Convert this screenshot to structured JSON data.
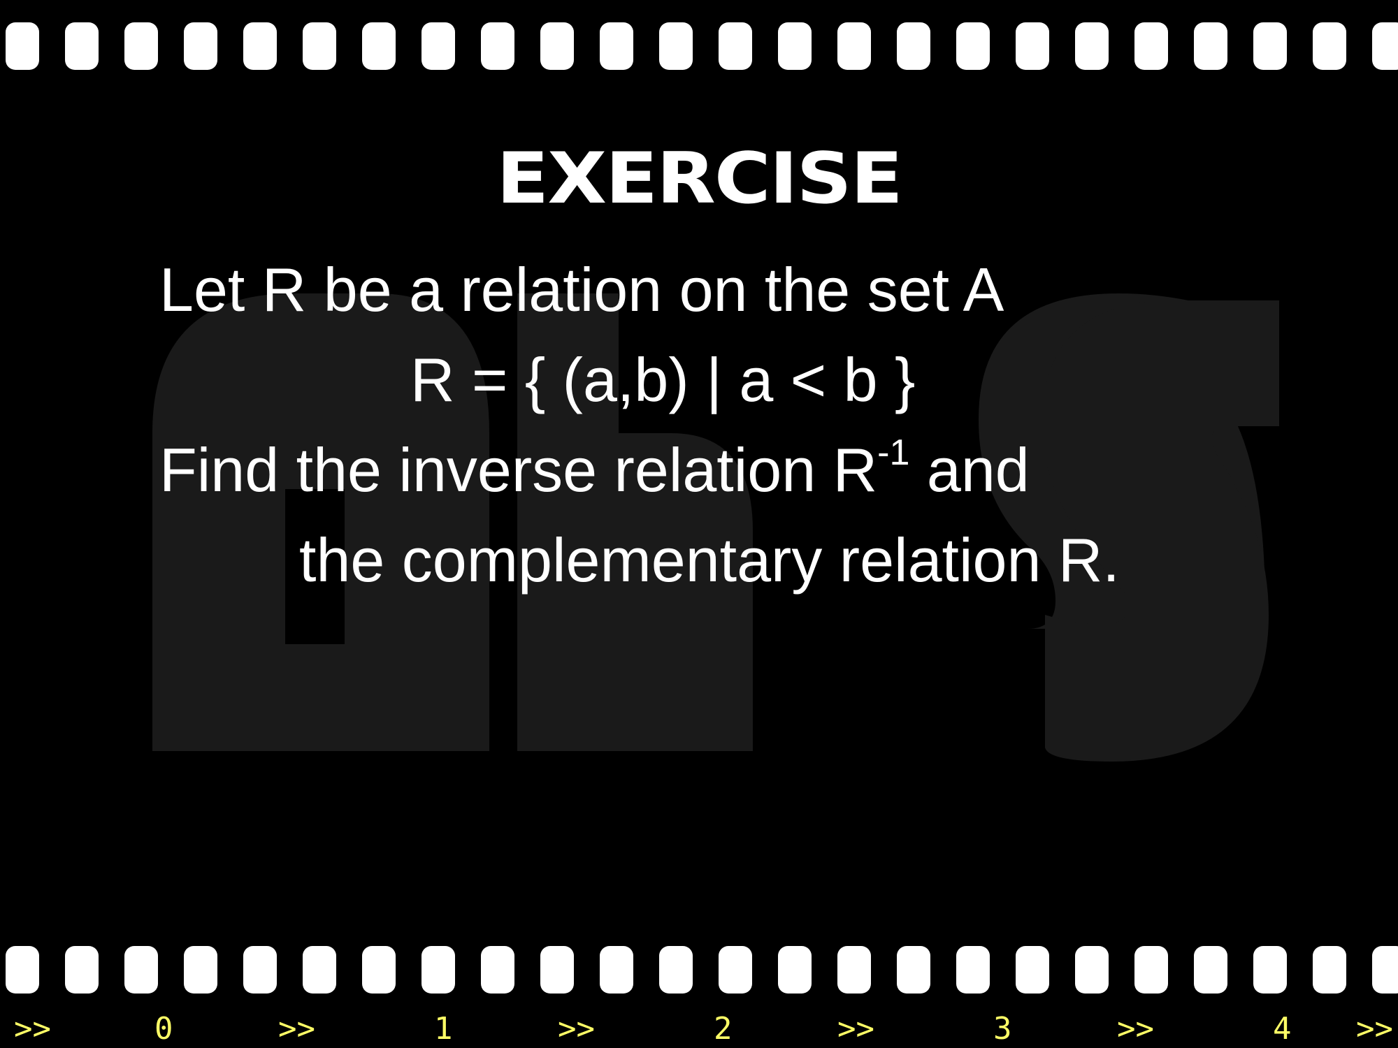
{
  "slide": {
    "title": "EXERCISE",
    "lines": {
      "line1": "Let R be a relation on the set A",
      "line2": "R = { (a,b) | a < b }",
      "line3_before": "Find the inverse relation R",
      "line3_sup": "-1",
      "line3_after": " and",
      "line4": "the complementary relation R."
    },
    "watermark_text": "ahs"
  },
  "film_counter": {
    "labels": [
      ">>",
      "0",
      ">>",
      "1",
      ">>",
      "2",
      ">>",
      "3",
      ">>",
      "4",
      ">>"
    ]
  },
  "colors": {
    "background": "#000000",
    "text": "#ffffff",
    "counter": "#ffff66",
    "watermark": "#1a1a1a"
  }
}
